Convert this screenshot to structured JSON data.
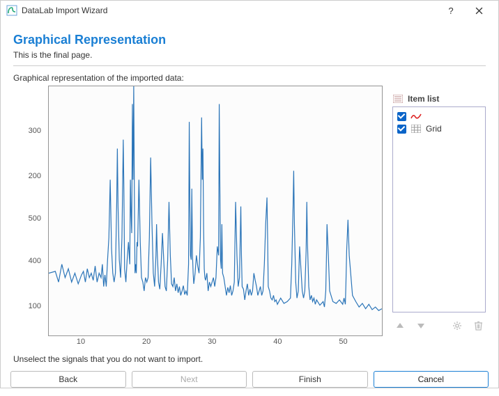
{
  "window": {
    "title": "DataLab Import Wizard"
  },
  "page": {
    "heading": "Graphical Representation",
    "subheading": "This is the final page.",
    "chart_label": "Graphical representation of the imported data:",
    "footer_label": "Unselect the signals that you do not want to import."
  },
  "item_list": {
    "header": "Item list",
    "items": [
      {
        "label": "",
        "icon": "signal-icon"
      },
      {
        "label": "Grid",
        "icon": "grid-icon"
      }
    ]
  },
  "buttons": {
    "back": "Back",
    "next": "Next",
    "finish": "Finish",
    "cancel": "Cancel"
  },
  "chart_data": {
    "type": "line",
    "title": "",
    "xlabel": "",
    "ylabel": "",
    "xlim": [
      5,
      56
    ],
    "ylim": [
      50,
      330
    ],
    "x_ticks": [
      10,
      20,
      30,
      40,
      50
    ],
    "y_ticks": [
      100,
      200,
      300,
      400,
      500
    ],
    "x": [
      5,
      6,
      6.5,
      7,
      7.5,
      8,
      8.5,
      9,
      9.5,
      10,
      10.3,
      10.6,
      10.9,
      11.2,
      11.5,
      11.8,
      12.1,
      12.4,
      12.7,
      13,
      13.2,
      13.4,
      13.6,
      13.8,
      14,
      14.2,
      14.4,
      14.6,
      14.8,
      15,
      15.2,
      15.4,
      15.5,
      15.6,
      15.8,
      16,
      16.2,
      16.4,
      16.5,
      16.6,
      16.8,
      17,
      17.2,
      17.4,
      17.5,
      17.6,
      17.7,
      17.8,
      17.9,
      18,
      18.1,
      18.2,
      18.3,
      18.4,
      18.5,
      18.6,
      18.8,
      19,
      19.2,
      19.4,
      19.6,
      19.8,
      20,
      20.2,
      20.4,
      20.6,
      20.8,
      21,
      21.2,
      21.4,
      21.5,
      21.6,
      21.8,
      22,
      22.2,
      22.4,
      22.6,
      22.8,
      23,
      23.2,
      23.4,
      23.6,
      23.8,
      24,
      24.2,
      24.4,
      24.6,
      24.8,
      25,
      25.2,
      25.4,
      25.6,
      25.8,
      26,
      26.2,
      26.4,
      26.5,
      26.6,
      26.7,
      26.8,
      26.9,
      27,
      27.1,
      27.2,
      27.4,
      27.6,
      27.8,
      28,
      28.2,
      28.4,
      28.5,
      28.6,
      28.7,
      28.8,
      28.9,
      29,
      29.2,
      29.4,
      29.6,
      29.8,
      30,
      30.2,
      30.4,
      30.6,
      30.8,
      31,
      31.1,
      31.2,
      31.3,
      31.4,
      31.5,
      31.6,
      31.8,
      32,
      32.2,
      32.4,
      32.6,
      32.8,
      33,
      33.2,
      33.4,
      33.6,
      33.8,
      34,
      34.2,
      34.4,
      34.5,
      34.6,
      34.8,
      35,
      35.2,
      35.4,
      35.6,
      35.8,
      36,
      36.2,
      36.4,
      36.6,
      36.8,
      37,
      37.2,
      37.4,
      37.6,
      37.8,
      38,
      38.2,
      38.4,
      38.5,
      38.6,
      38.8,
      39,
      39.2,
      39.4,
      39.6,
      39.8,
      40,
      40.5,
      41,
      41.5,
      42,
      42.2,
      42.4,
      42.5,
      42.6,
      42.8,
      43,
      43.2,
      43.4,
      43.6,
      43.8,
      44,
      44.2,
      44.4,
      44.5,
      44.6,
      44.8,
      45,
      45.2,
      45.4,
      45.6,
      45.8,
      46,
      46.5,
      47,
      47.2,
      47.4,
      47.5,
      47.6,
      47.8,
      48,
      48.5,
      49,
      49.5,
      50,
      50.2,
      50.4,
      50.5,
      50.6,
      50.8,
      51,
      51.5,
      52,
      52.5,
      53,
      53.5,
      54,
      54.5,
      55,
      55.5,
      56
    ],
    "values": [
      120,
      122,
      110,
      130,
      115,
      125,
      110,
      120,
      108,
      118,
      122,
      110,
      125,
      115,
      120,
      112,
      128,
      110,
      120,
      115,
      130,
      105,
      118,
      105,
      135,
      160,
      225,
      148,
      120,
      110,
      120,
      200,
      260,
      195,
      135,
      115,
      160,
      270,
      215,
      125,
      110,
      135,
      155,
      130,
      225,
      185,
      165,
      310,
      225,
      330,
      210,
      120,
      130,
      120,
      155,
      150,
      225,
      155,
      115,
      110,
      100,
      115,
      110,
      115,
      160,
      250,
      175,
      120,
      105,
      140,
      175,
      145,
      110,
      102,
      130,
      165,
      135,
      105,
      100,
      135,
      200,
      140,
      108,
      105,
      115,
      100,
      108,
      98,
      105,
      95,
      100,
      106,
      96,
      100,
      95,
      130,
      290,
      195,
      140,
      135,
      215,
      140,
      120,
      108,
      120,
      140,
      128,
      120,
      160,
      295,
      225,
      260,
      170,
      125,
      115,
      112,
      120,
      100,
      110,
      105,
      110,
      115,
      105,
      115,
      150,
      140,
      310,
      210,
      135,
      125,
      175,
      120,
      115,
      105,
      95,
      104,
      98,
      106,
      95,
      100,
      110,
      200,
      140,
      105,
      115,
      195,
      140,
      105,
      102,
      90,
      100,
      108,
      95,
      102,
      95,
      100,
      120,
      112,
      105,
      95,
      100,
      105,
      95,
      100,
      130,
      175,
      205,
      160,
      105,
      100,
      92,
      90,
      95,
      88,
      90,
      85,
      92,
      86,
      88,
      92,
      130,
      195,
      235,
      175,
      110,
      92,
      100,
      150,
      125,
      100,
      92,
      100,
      145,
      200,
      155,
      105,
      90,
      95,
      88,
      92,
      85,
      90,
      84,
      88,
      82,
      100,
      135,
      175,
      140,
      100,
      88,
      86,
      90,
      85,
      92,
      85,
      110,
      145,
      180,
      140,
      95,
      88,
      82,
      86,
      80,
      85,
      79,
      82,
      78,
      80,
      76
    ]
  }
}
